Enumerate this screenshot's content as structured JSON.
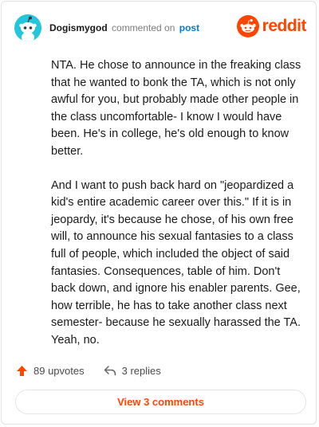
{
  "header": {
    "username": "Dogismygod",
    "action_text": "commented on",
    "post_link": "post",
    "brand_word": "reddit"
  },
  "comment": {
    "paragraphs": [
      "NTA. He chose to announce in the freaking class that he wanted to bonk the TA, which is not only awful for you, but probably made other people in the class uncomfortable- I know I would have been. He's in college, he's old enough to know better.",
      "And I want to push back hard on \"jeopardized a kid's entire academic career over this.\" If it is in jeopardy, it's because he chose, of his own free will, to announce his sexual fantasies to a class full of people, which included the object of said fantasies. Consequences, table of him. Don't back down, and ignore his enabler parents. Gee, how terrible, he has to take another class next semester- because he sexually harassed the TA. Yeah, no."
    ]
  },
  "actions": {
    "upvotes_label": "89 upvotes",
    "replies_label": "3 replies"
  },
  "footer": {
    "view_comments_label": "View 3 comments"
  },
  "icons": {
    "avatar": "snoo-avatar-icon",
    "brand": "reddit-logo-icon",
    "upvote": "upvote-arrow-icon",
    "reply": "reply-arrow-icon"
  },
  "colors": {
    "brand": "#ff4500",
    "link": "#0079d3",
    "avatar_bg": "#26c6da"
  }
}
